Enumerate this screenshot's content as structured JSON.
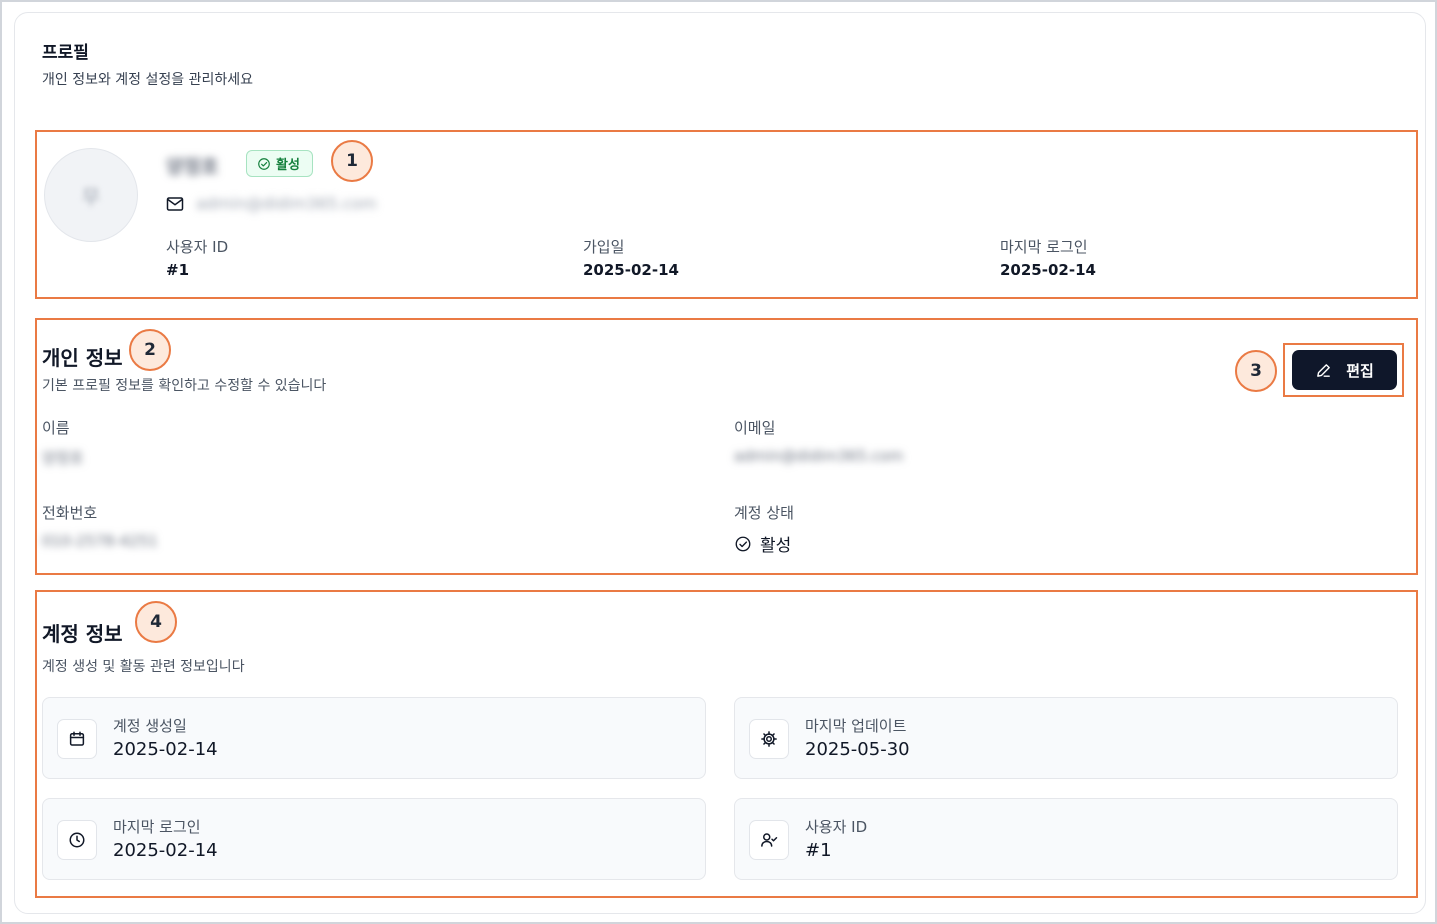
{
  "header": {
    "title": "프로필",
    "subtitle": "개인 정보와 계정 설정을 관리하세요"
  },
  "annotations": [
    "1",
    "2",
    "3",
    "4"
  ],
  "profile_card": {
    "avatar_initial": "무",
    "name": "양정호",
    "status_badge": "활성",
    "email": "admin@didim365.com",
    "meta": [
      {
        "label": "사용자 ID",
        "value": "#1"
      },
      {
        "label": "가입일",
        "value": "2025-02-14"
      },
      {
        "label": "마지막 로그인",
        "value": "2025-02-14"
      }
    ]
  },
  "personal_info": {
    "title": "개인 정보",
    "subtitle": "기본 프로필 정보를 확인하고 수정할 수 있습니다",
    "edit_label": "편집",
    "fields": {
      "name_label": "이름",
      "name_value": "양정호",
      "email_label": "이메일",
      "email_value": "admin@didim365.com",
      "phone_label": "전화번호",
      "phone_value": "010-2578-4251",
      "status_label": "계정 상태",
      "status_value": "활성"
    }
  },
  "account_info": {
    "title": "계정 정보",
    "subtitle": "계정 생성 및 활동 관련 정보입니다",
    "tiles": [
      {
        "icon": "calendar-icon",
        "label": "계정 생성일",
        "value": "2025-02-14"
      },
      {
        "icon": "gear-icon",
        "label": "마지막 업데이트",
        "value": "2025-05-30"
      },
      {
        "icon": "clock-icon",
        "label": "마지막 로그인",
        "value": "2025-02-14"
      },
      {
        "icon": "user-check-icon",
        "label": "사용자 ID",
        "value": "#1"
      }
    ]
  },
  "colors": {
    "highlight": "#ea7a44",
    "badge_green": "#15803d",
    "button_dark": "#0f172a"
  }
}
